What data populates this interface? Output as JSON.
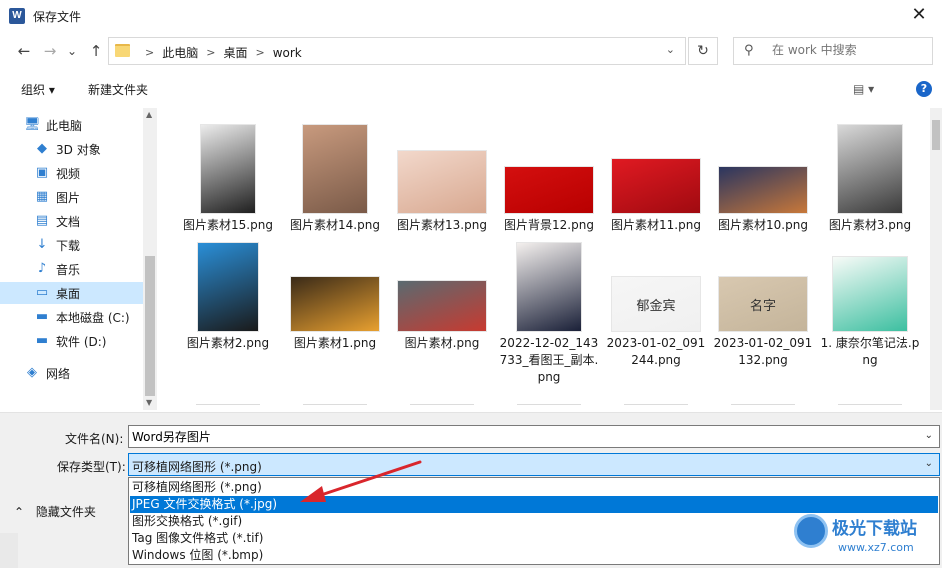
{
  "window": {
    "title": "保存文件",
    "app_icon_letter": "W",
    "close_glyph": "✕"
  },
  "nav": {
    "back_glyph": "←",
    "forward_glyph": "→",
    "recent_glyph": "⌄",
    "up_glyph": "↑",
    "breadcrumb": [
      "此电脑",
      "桌面",
      "work"
    ],
    "crumb_sep": ">",
    "dropdown_glyph": "⌄",
    "refresh_glyph": "↻",
    "search_placeholder": "在 work 中搜索"
  },
  "toolbar": {
    "organize": "组织 ▾",
    "new_folder": "新建文件夹",
    "view_glyph": "▤ ▾",
    "help_glyph": "?"
  },
  "sidebar": {
    "items": [
      {
        "label": "此电脑",
        "icon": "computer-icon",
        "glyph": "🖥"
      },
      {
        "label": "3D 对象",
        "icon": "cube-icon",
        "glyph": "◆"
      },
      {
        "label": "视频",
        "icon": "video-icon",
        "glyph": "▣"
      },
      {
        "label": "图片",
        "icon": "pictures-icon",
        "glyph": "▦"
      },
      {
        "label": "文档",
        "icon": "document-icon",
        "glyph": "▤"
      },
      {
        "label": "下载",
        "icon": "download-icon",
        "glyph": "↓"
      },
      {
        "label": "音乐",
        "icon": "music-icon",
        "glyph": "♪"
      },
      {
        "label": "桌面",
        "icon": "desktop-icon",
        "glyph": "▭"
      },
      {
        "label": "本地磁盘 (C:)",
        "icon": "drive-c-icon",
        "glyph": "▬"
      },
      {
        "label": "软件 (D:)",
        "icon": "drive-d-icon",
        "glyph": "▬"
      },
      {
        "label": "网络",
        "icon": "network-icon",
        "glyph": "◈"
      }
    ],
    "scroll_up": "▲",
    "scroll_down": "▼"
  },
  "files": [
    {
      "name": "图片素材15.png",
      "colors": [
        "#ececec",
        "#1f1f1f"
      ]
    },
    {
      "name": "图片素材14.png",
      "colors": [
        "#c89a7e",
        "#7a5a48"
      ]
    },
    {
      "name": "图片素材13.png",
      "colors": [
        "#f2d8cb",
        "#d8a890"
      ]
    },
    {
      "name": "图片背景12.png",
      "colors": [
        "#d40f0f",
        "#b80000"
      ]
    },
    {
      "name": "图片素材11.png",
      "colors": [
        "#e01a22",
        "#a00a10"
      ]
    },
    {
      "name": "图片素材10.png",
      "colors": [
        "#2a3560",
        "#c8783a"
      ]
    },
    {
      "name": "图片素材3.png",
      "colors": [
        "#d9d9d9",
        "#3a3a3a"
      ]
    },
    {
      "name": "图片素材2.png",
      "colors": [
        "#2a8fd8",
        "#1a1a1a"
      ]
    },
    {
      "name": "图片素材1.png",
      "colors": [
        "#3a2a18",
        "#e8a030"
      ]
    },
    {
      "name": "图片素材.png",
      "colors": [
        "#5a6a70",
        "#c83a30"
      ]
    },
    {
      "name": "2022-12-02_143733_看图王_副本.png",
      "colors": [
        "#f4f0ee",
        "#1a2038"
      ]
    },
    {
      "name": "2023-01-02_091244.png",
      "colors": [
        "#f6f6f6",
        "#f0f0f0"
      ]
    },
    {
      "name": "2023-01-02_091132.png",
      "colors": [
        "#d8c8b0",
        "#c4b49a"
      ]
    },
    {
      "name": "1. 康奈尔笔记法.png",
      "colors": [
        "#f8fbf8",
        "#3cbfa0"
      ]
    }
  ],
  "thumb_text": {
    "sig1": "郁金宾",
    "sig2": "名字"
  },
  "form": {
    "filename_label": "文件名(N):",
    "filename_value": "Word另存图片",
    "type_label": "保存类型(T):",
    "type_value": "可移植网络图形 (*.png)",
    "dropdown_glyph": "⌄",
    "options": [
      "可移植网络图形 (*.png)",
      "JPEG 文件交换格式 (*.jpg)",
      "图形交换格式 (*.gif)",
      "Tag 图像文件格式 (*.tif)",
      "Windows 位图 (*.bmp)"
    ],
    "highlighted_option": 1,
    "hide_folders": "隐藏文件夹",
    "hide_glyph": "⌃"
  },
  "watermark": {
    "brand": "极光下载站",
    "url": "www.xz7.com"
  },
  "colors": {
    "accent": "#0078d7",
    "selection": "#cce8ff",
    "arrow": "#d9262c"
  }
}
